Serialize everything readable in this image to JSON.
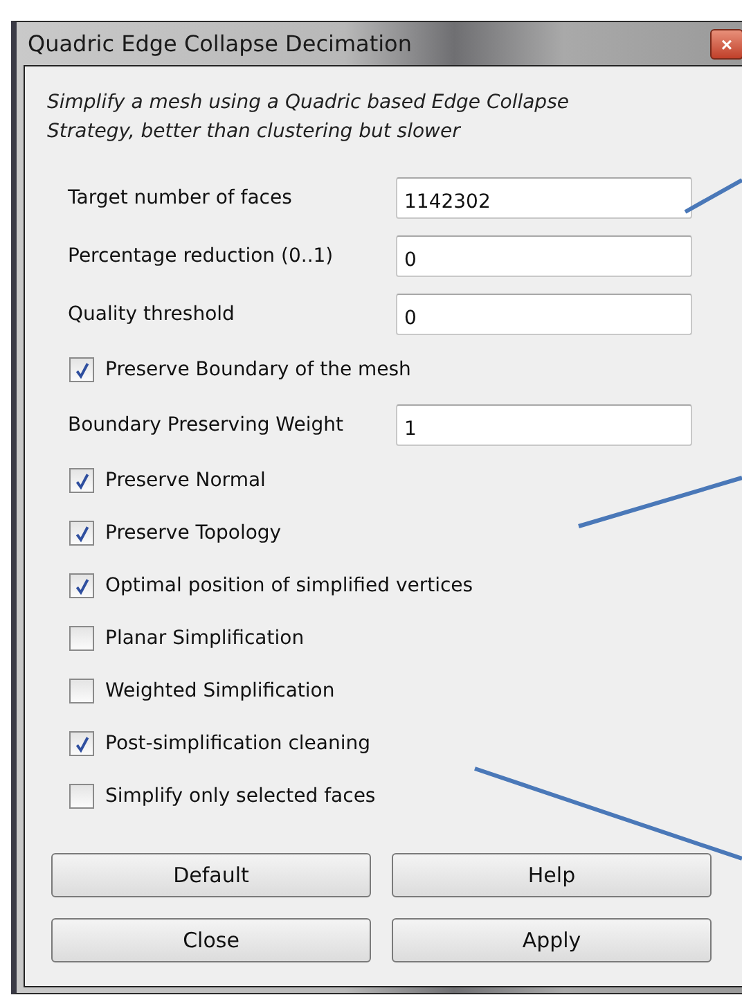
{
  "window": {
    "title": "Quadric Edge Collapse Decimation",
    "close": "×"
  },
  "description": "Simplify a mesh using a Quadric based Edge Collapse Strategy, better than clustering but slower",
  "parameters": [
    {
      "kind": "field",
      "label": "Target number of faces",
      "value": "1142302"
    },
    {
      "kind": "field",
      "label": "Percentage reduction (0..1)",
      "value": "0"
    },
    {
      "kind": "field",
      "label": "Quality threshold",
      "value": "0"
    },
    {
      "kind": "checkbox",
      "label": "Preserve Boundary of the mesh",
      "checked": true
    },
    {
      "kind": "field",
      "label": "Boundary Preserving Weight",
      "value": "1"
    },
    {
      "kind": "checkbox",
      "label": "Preserve Normal",
      "checked": true
    },
    {
      "kind": "checkbox",
      "label": "Preserve Topology",
      "checked": true
    },
    {
      "kind": "checkbox",
      "label": "Optimal position of simplified vertices",
      "checked": true
    },
    {
      "kind": "checkbox",
      "label": "Planar Simplification",
      "checked": false
    },
    {
      "kind": "checkbox",
      "label": "Weighted Simplification",
      "checked": false
    },
    {
      "kind": "checkbox",
      "label": "Post-simplification cleaning",
      "checked": true
    },
    {
      "kind": "checkbox",
      "label": "Simplify only selected faces",
      "checked": false
    }
  ],
  "buttons": [
    "Default",
    "Help",
    "Close",
    "Apply"
  ]
}
